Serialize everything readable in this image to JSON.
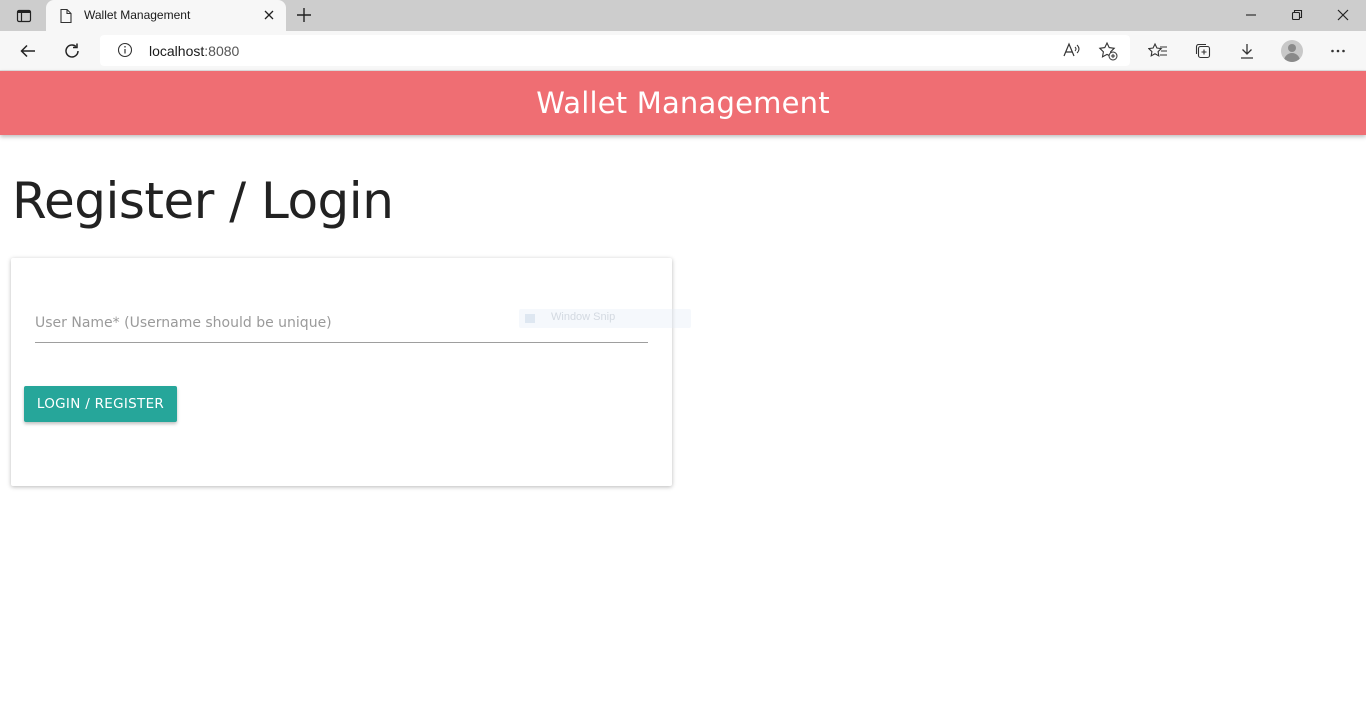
{
  "browser": {
    "tab_title": "Wallet Management",
    "url_host": "localhost",
    "url_port": ":8080",
    "icons": [
      "tab-actions-icon",
      "page-icon",
      "close-icon",
      "plus-icon",
      "minimize-icon",
      "restore-icon",
      "close-window-icon",
      "back-icon",
      "refresh-icon",
      "info-icon",
      "read-aloud-icon",
      "add-favorite-icon",
      "favorites-icon",
      "collections-icon",
      "download-icon",
      "profile-icon",
      "more-icon"
    ]
  },
  "app": {
    "header_title": "Wallet Management",
    "page_title": "Register / Login",
    "username_placeholder": "User Name* (Username should be unique)",
    "username_value": "",
    "submit_label": "LOGIN / REGISTER",
    "accent_color": "#26a69a",
    "header_color": "#ef6e73"
  },
  "overlay": {
    "ghost_label": "Window Snip"
  }
}
